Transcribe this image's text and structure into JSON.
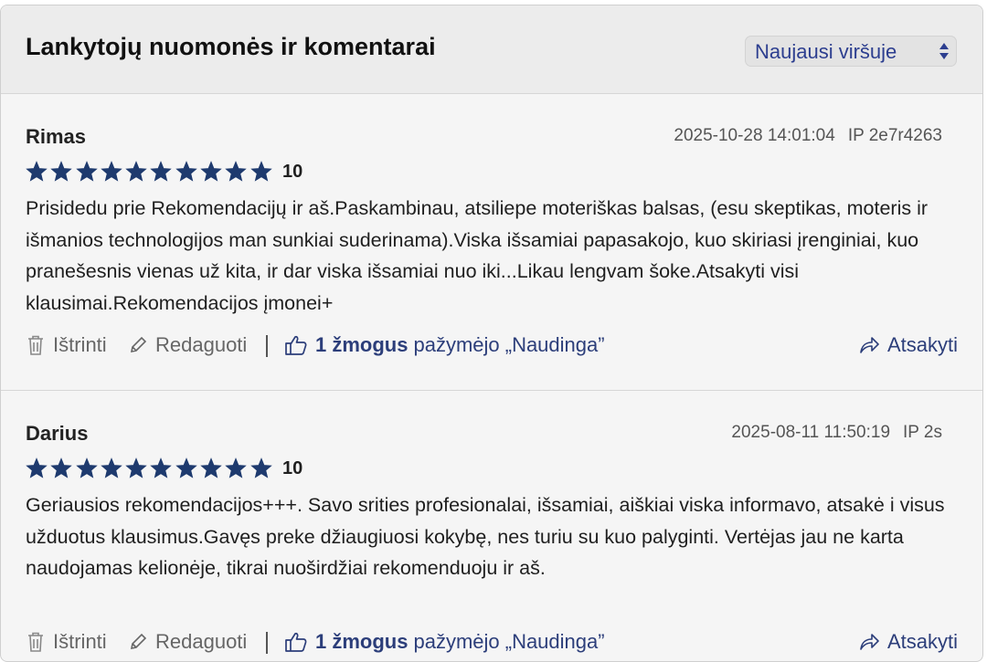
{
  "header": {
    "title": "Lankytojų nuomonės ir komentarai",
    "sort_selected": "Naujausi viršuje"
  },
  "comments": [
    {
      "author": "Rimas",
      "date": "2025-10-28 14:01:04",
      "ip": "IP 2e7r4263",
      "rating": 10,
      "rating_max": 10,
      "rating_label": "10",
      "text": "Prisidedu prie Rekomendacijų ir aš.Paskambinau, atsiliepe moteriškas balsas, (esu skeptikas, moteris ir išmanios technologijos man sunkiai suderinama).Viska išsamiai papasakojo, kuo skiriasi įrenginiai, kuo pranešesnis vienas už kita, ir dar viska išsamiai nuo iki...Likau lengvam šoke.Atsakyti visi klausimai.Rekomendacijos įmonei+",
      "delete_label": "Ištrinti",
      "edit_label": "Redaguoti",
      "useful_count": "1 žmogus",
      "useful_label": "pažymėjo „Naudinga”",
      "reply_label": "Atsakyti"
    },
    {
      "author": "Darius",
      "date": "2025-08-11 11:50:19",
      "ip": "IP 2s",
      "rating": 10,
      "rating_max": 10,
      "rating_label": "10",
      "text": "Geriausios rekomendacijos+++. Savo srities profesionalai, išsamiai, aiškiai viska informavo, atsakė i visus užduotus klausimus.Gavęs preke džiaugiuosi kokybę, nes turiu su kuo palyginti. Vertėjas jau ne karta naudojamas kelionėje, tikrai nuoširdžiai rekomenduoju ir aš.",
      "delete_label": "Ištrinti",
      "edit_label": "Redaguoti",
      "useful_count": "1 žmogus",
      "useful_label": "pažymėjo „Naudinga”",
      "reply_label": "Atsakyti"
    }
  ],
  "colors": {
    "star": "#1e3a6e",
    "accent": "#2c3e7a",
    "select_text": "#2c3e8f",
    "muted": "#666666"
  }
}
